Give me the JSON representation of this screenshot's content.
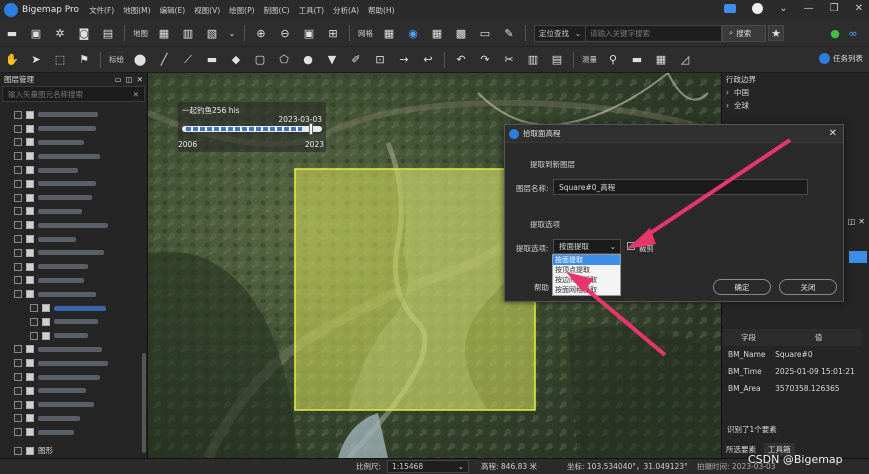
{
  "app": {
    "title": "Bigemap Pro"
  },
  "menu": [
    "文件(F)",
    "地图(M)",
    "编辑(E)",
    "视图(V)",
    "绘图(P)",
    "制图(C)",
    "工具(T)",
    "分析(A)",
    "帮助(H)"
  ],
  "toolbar1": {
    "map_label": "地图",
    "grid_label": "网格",
    "locate_combo": "定位查找",
    "search_placeholder": "请输入关键字搜索",
    "search_button": "搜索"
  },
  "toolbar2": {
    "annotate_label": "标绘",
    "measure_label": "测量",
    "task_list": "任务列表"
  },
  "left_panel": {
    "title": "图层管理",
    "search_placeholder": "输入矢量图元名称搜索",
    "footer_item": "图形"
  },
  "map": {
    "timeline_label": "一起钓鱼256 his",
    "timeline_date": "2023-03-03",
    "timeline_start": "2006",
    "timeline_end": "2023"
  },
  "right_panel": {
    "title": "行政边界",
    "tree": [
      "中国",
      "全球"
    ],
    "table_header": {
      "field": "字段",
      "value": "值"
    },
    "attributes": [
      {
        "field": "BM_Name",
        "value": "Square#0"
      },
      {
        "field": "BM_Time",
        "value": "2025-01-09 15:01:21"
      },
      {
        "field": "BM_Area",
        "value": "3570358.126365"
      }
    ],
    "identified": "识别了1个要素",
    "tabs": [
      "所选要素",
      "工具箱"
    ]
  },
  "dialog": {
    "title": "拾取面高程",
    "section1": "提取到新图层",
    "layer_name_label": "图层名称:",
    "layer_name_value": "Square#0_高程",
    "section2": "提取选项",
    "option_label": "提取选项:",
    "option_value": "按面提取",
    "clip_label": "裁剪",
    "clip_checked": true,
    "help": "帮助",
    "ok": "确定",
    "close": "关闭",
    "options": [
      "按面提取",
      "按顶点提取",
      "按边间隔提取",
      "按面网格提取"
    ]
  },
  "status": {
    "scale_label": "比例尺:",
    "scale_value": "1:15468",
    "elevation": "高程: 846.83 米",
    "coords": "坐标: 103.534040°，31.049123°",
    "shot_time": "拍摄时间: 2023-03-03",
    "watermark": "CSDN @Bigemap"
  },
  "colors": {
    "accent": "#2e7de0",
    "highlight_fill": "#d6e05a",
    "highlight_border": "#e8ee3a",
    "arrow": "#e8356b"
  }
}
